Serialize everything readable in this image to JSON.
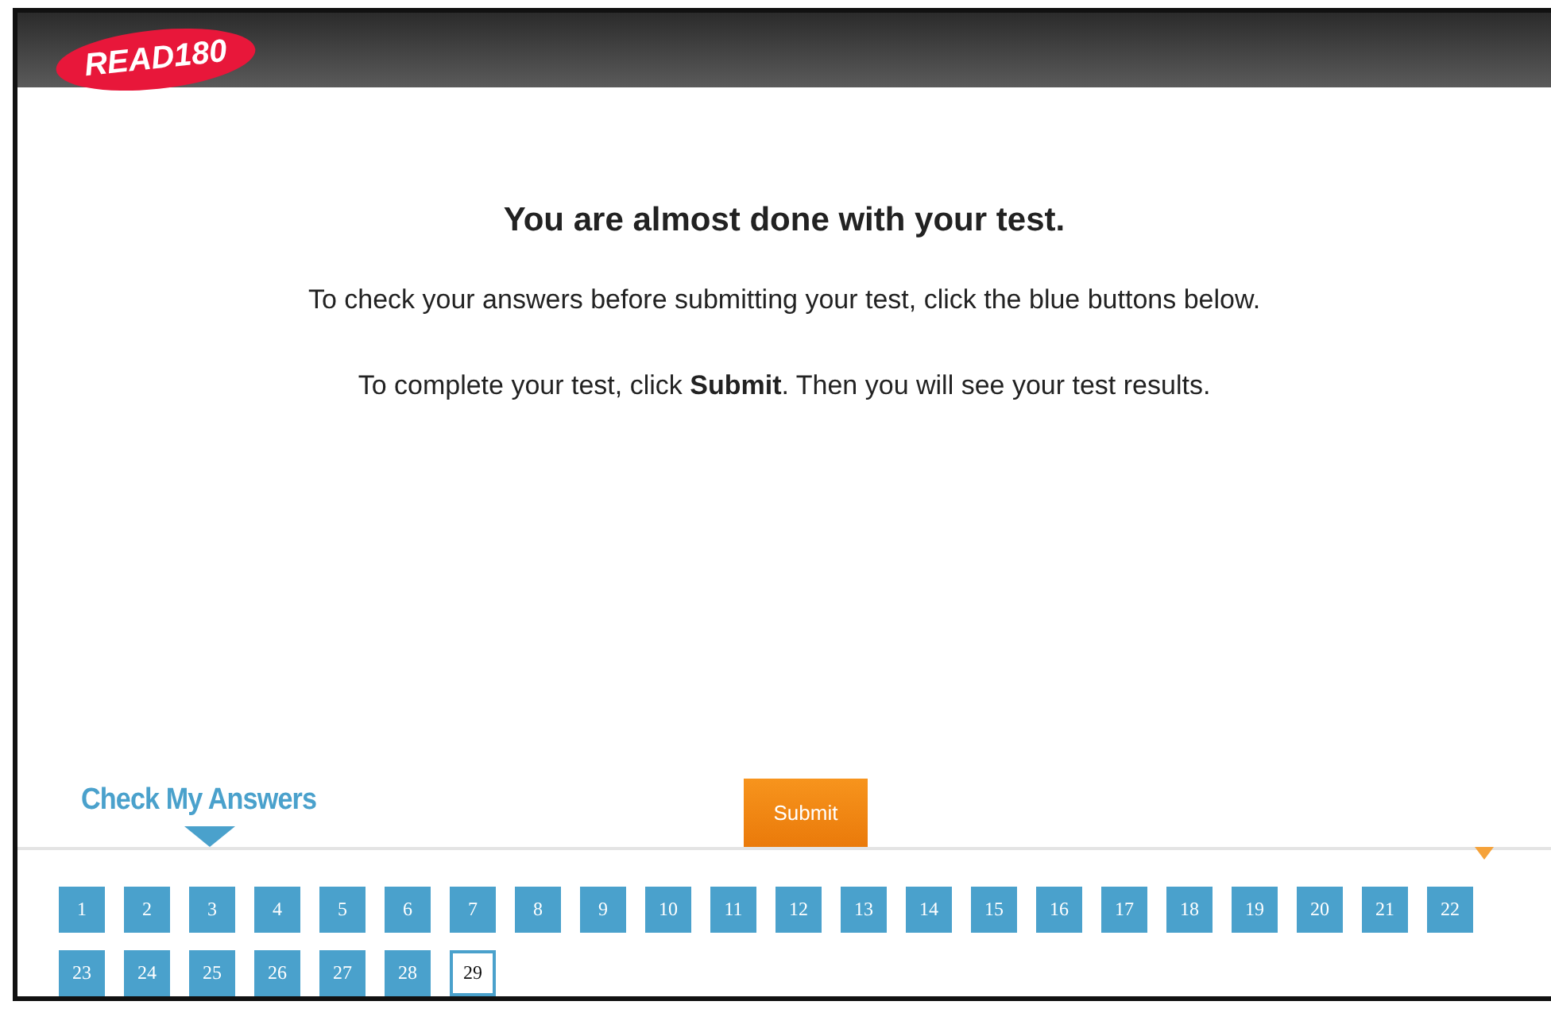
{
  "header": {
    "logo": "READ180"
  },
  "message": {
    "title": "You are almost done with your test.",
    "lines": [
      "To check your answers before submitting your test, click the blue buttons below.",
      "To complete your test, click **Submit**. Then you will see your test results."
    ]
  },
  "answers": {
    "label": "Check My Answers",
    "submit": "Submit",
    "questions": [
      {
        "label": "1",
        "selected": false
      },
      {
        "label": "2",
        "selected": false
      },
      {
        "label": "3",
        "selected": false
      },
      {
        "label": "4",
        "selected": false
      },
      {
        "label": "5",
        "selected": false
      },
      {
        "label": "6",
        "selected": false
      },
      {
        "label": "7",
        "selected": false
      },
      {
        "label": "8",
        "selected": false
      },
      {
        "label": "9",
        "selected": false
      },
      {
        "label": "10",
        "selected": false
      },
      {
        "label": "11",
        "selected": false
      },
      {
        "label": "12",
        "selected": false
      },
      {
        "label": "13",
        "selected": false
      },
      {
        "label": "14",
        "selected": false
      },
      {
        "label": "15",
        "selected": false
      },
      {
        "label": "16",
        "selected": false
      },
      {
        "label": "17",
        "selected": false
      },
      {
        "label": "18",
        "selected": false
      },
      {
        "label": "19",
        "selected": false
      },
      {
        "label": "20",
        "selected": false
      },
      {
        "label": "21",
        "selected": false
      },
      {
        "label": "22",
        "selected": false
      },
      {
        "label": "23",
        "selected": false
      },
      {
        "label": "24",
        "selected": false
      },
      {
        "label": "25",
        "selected": false
      },
      {
        "label": "26",
        "selected": false
      },
      {
        "label": "27",
        "selected": false
      },
      {
        "label": "28",
        "selected": false
      },
      {
        "label": "29",
        "selected": true
      }
    ]
  }
}
